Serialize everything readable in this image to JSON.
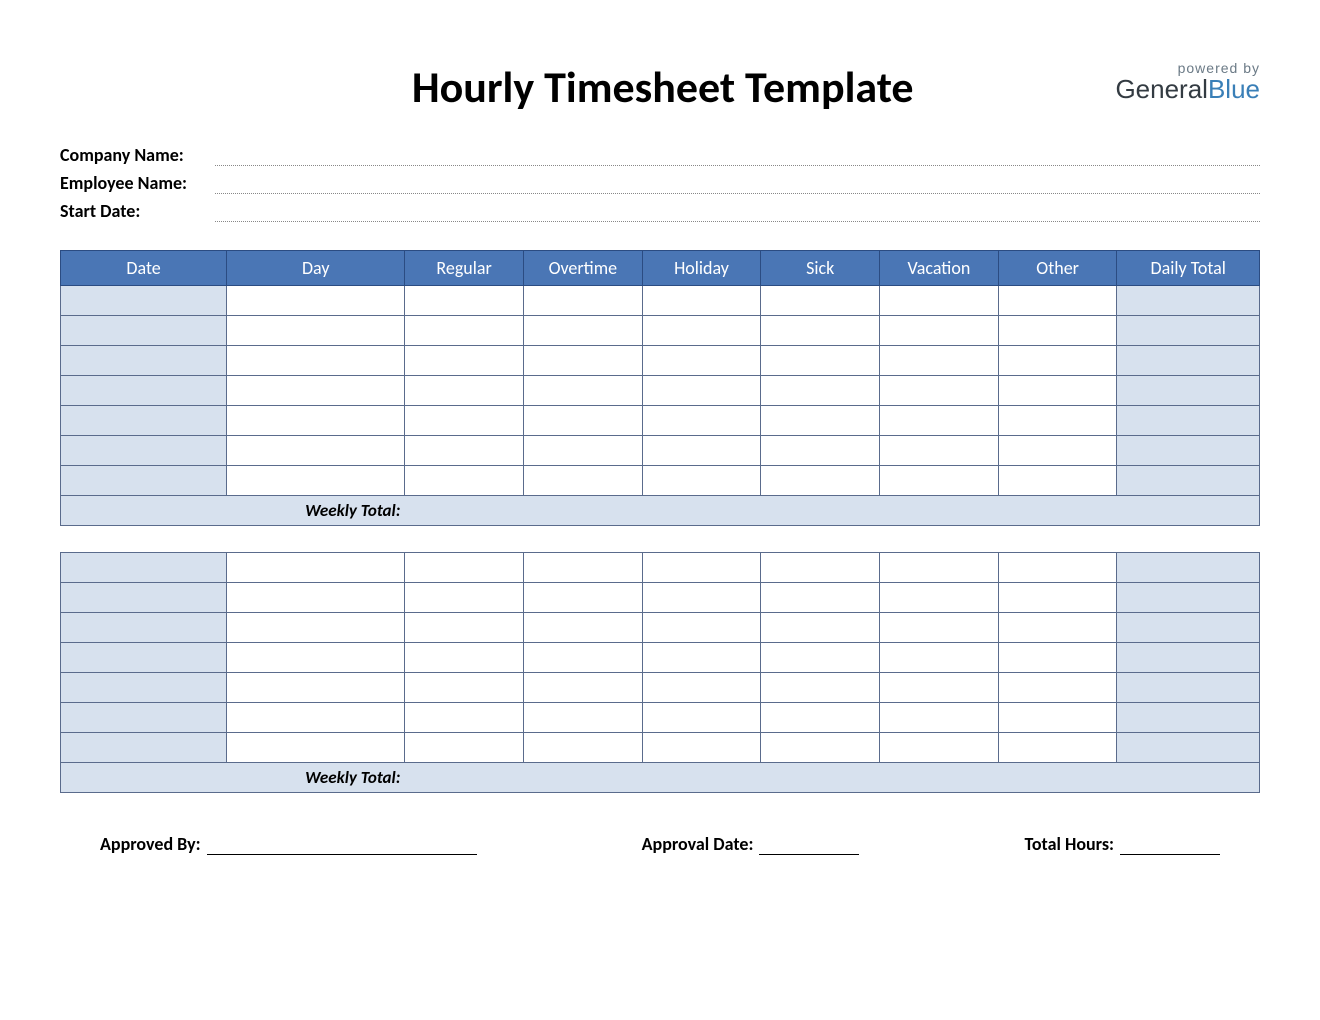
{
  "title": "Hourly Timesheet Template",
  "logo": {
    "powered": "powered by",
    "brand_a": "General",
    "brand_b": "Blue"
  },
  "info": {
    "company_label": "Company Name:",
    "employee_label": "Employee Name:",
    "startdate_label": "Start Date:"
  },
  "columns": [
    "Date",
    "Day",
    "Regular",
    "Overtime",
    "Holiday",
    "Sick",
    "Vacation",
    "Other",
    "Daily Total"
  ],
  "weekly_total_label": "Weekly Total:",
  "footer": {
    "approved_by": "Approved By:",
    "approval_date": "Approval Date:",
    "total_hours": "Total Hours:"
  },
  "weeks": 2,
  "rows_per_week": 7
}
